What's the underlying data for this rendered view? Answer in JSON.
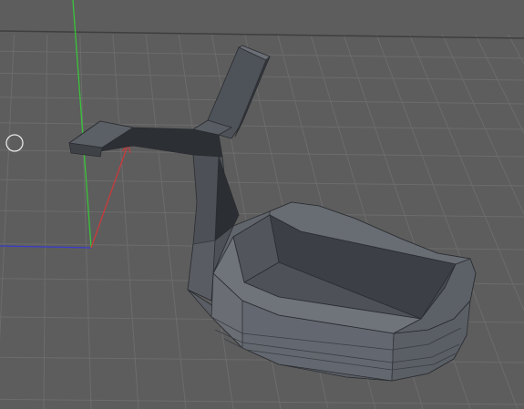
{
  "viewport": {
    "background": "#5c5c5c",
    "grid_color": "#6c6c6c",
    "horizon_line_color": "#444444",
    "axis_colors": {
      "x": "#cc3a3a",
      "y": "#3ac43a",
      "z": "#3a3acc"
    }
  },
  "objects": [
    {
      "name": "lowpoly-mesh",
      "shading": "flat-gray",
      "base_color": "#4c4f54"
    }
  ],
  "cursor": {
    "type": "circle-cursor"
  },
  "icons": [
    "circle-cursor-icon",
    "axis-gizmo-icon"
  ]
}
